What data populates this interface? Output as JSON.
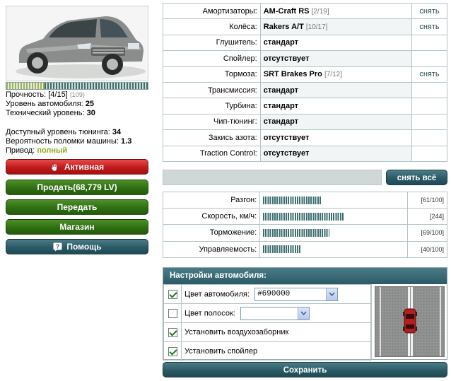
{
  "left": {
    "durability": {
      "label": "Прочность:",
      "value": "[4/15]",
      "extra": "(109)",
      "fill_fraction": 0.27
    },
    "car_level": {
      "label": "Уровень автомобиля:",
      "value": "25"
    },
    "tech_level": {
      "label": "Технический уровень:",
      "value": "30"
    },
    "tuning_level": {
      "label": "Доступный уровень тюнинга:",
      "value": "34"
    },
    "breakdown": {
      "label": "Вероятность поломки машины:",
      "value": "1.3"
    },
    "drive": {
      "label": "Привод:",
      "value": "полный"
    },
    "buttons": {
      "active": "Активная",
      "sell": "Продать(68,779 LV)",
      "transfer": "Передать",
      "shop": "Магазин",
      "help": "Помощь"
    }
  },
  "parts": {
    "remove_label": "снять",
    "rows": [
      {
        "label": "Амортизаторы:",
        "value": "AM-Craft RS",
        "extra": "[2/19]",
        "removable": true
      },
      {
        "label": "Колёса:",
        "value": "Rakers A/T",
        "extra": "[10/17]",
        "removable": true
      },
      {
        "label": "Глушитель:",
        "value": "стандарт",
        "extra": "",
        "removable": false
      },
      {
        "label": "Спойлер:",
        "value": "отсутствует",
        "extra": "",
        "removable": false
      },
      {
        "label": "Тормоза:",
        "value": "SRT Brakes Pro",
        "extra": "[7/12]",
        "removable": true
      },
      {
        "label": "Трансмиссия:",
        "value": "стандарт",
        "extra": "",
        "removable": false
      },
      {
        "label": "Турбина:",
        "value": "стандарт",
        "extra": "",
        "removable": false
      },
      {
        "label": "Чип-тюнинг:",
        "value": "стандарт",
        "extra": "",
        "removable": false
      },
      {
        "label": "Закись азота:",
        "value": "отсутствует",
        "extra": "",
        "removable": false
      },
      {
        "label": "Traction Control:",
        "value": "отсутствует",
        "extra": "",
        "removable": false
      }
    ],
    "remove_all_label": "снять всё"
  },
  "performance": {
    "rows": [
      {
        "label": "Разгон:",
        "display": "[61/100]",
        "fraction": 0.41
      },
      {
        "label": "Скорость, км/ч:",
        "display": "[244]",
        "fraction": 0.57
      },
      {
        "label": "Торможение:",
        "display": "[69/100]",
        "fraction": 0.47
      },
      {
        "label": "Управляемость:",
        "display": "[40/100]",
        "fraction": 0.27
      }
    ]
  },
  "settings": {
    "title": "Настройки автомобиля:",
    "car_color": {
      "label": "Цвет автомобиля:",
      "value": "#690000",
      "checked": true
    },
    "stripe_color": {
      "label": "Цвет полосок:",
      "value": "",
      "checked": false
    },
    "air_intake": {
      "label": "Установить воздухозаборник",
      "checked": true
    },
    "spoiler": {
      "label": "Установить спойлер",
      "checked": true
    },
    "preview_car_color": "#b31f1f",
    "save_label": "Сохранить"
  },
  "colors": {
    "accent_teal": "#2a5a66",
    "green_button": "#2f6f12",
    "red_button": "#c01a1a",
    "drive_value": "#8fa81e"
  }
}
